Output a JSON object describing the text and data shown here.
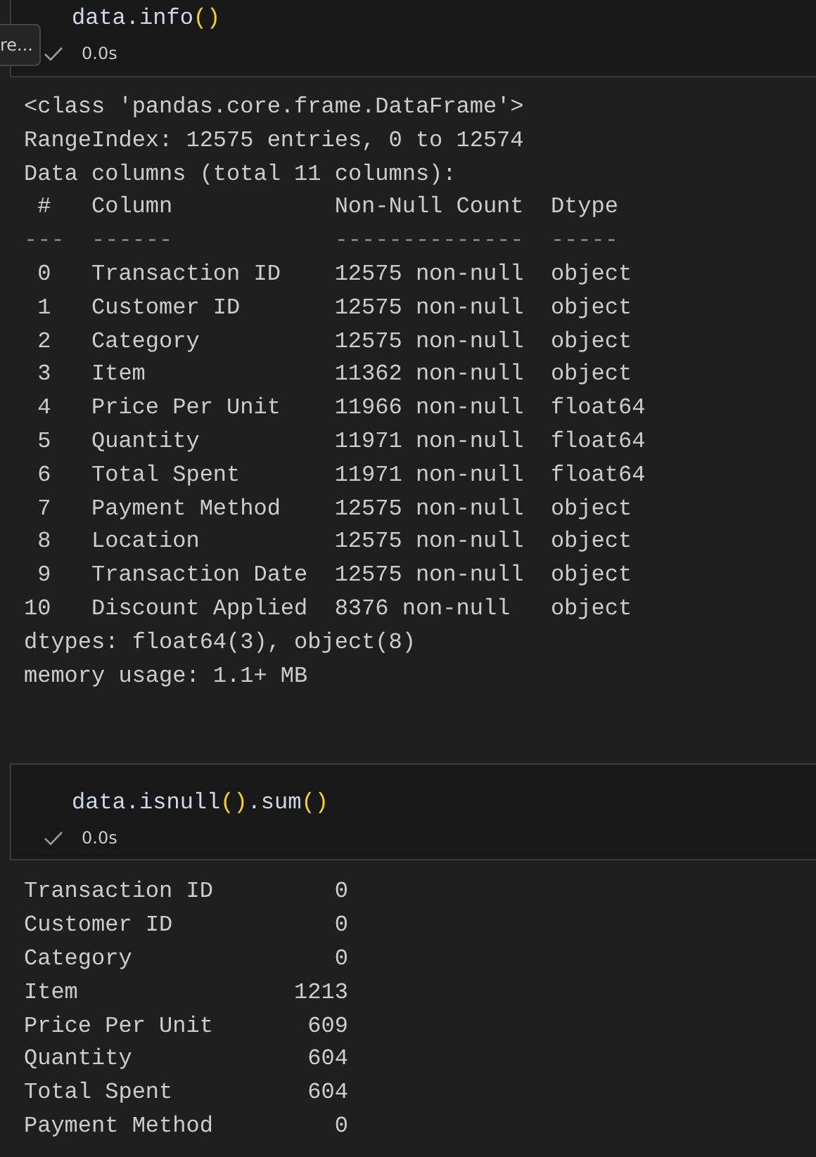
{
  "cells": [
    {
      "code": [
        {
          "text": "data.info",
          "kind": "name"
        },
        {
          "text": "()",
          "kind": "bracket"
        }
      ],
      "time": "0.0s",
      "tooltip": "re...",
      "output": {
        "kind": "info",
        "preamble": [
          "<class 'pandas.core.frame.DataFrame'>",
          "RangeIndex: 12575 entries, 0 to 12574",
          "Data columns (total 11 columns):"
        ],
        "header": [
          "#",
          "Column",
          "Non-Null Count",
          "Dtype"
        ],
        "rule": [
          "---",
          "------",
          "--------------",
          "-----"
        ],
        "rows": [
          {
            "index": "0",
            "column": "Transaction ID",
            "count": "12575 non-null",
            "dtype": "object"
          },
          {
            "index": "1",
            "column": "Customer ID",
            "count": "12575 non-null",
            "dtype": "object"
          },
          {
            "index": "2",
            "column": "Category",
            "count": "12575 non-null",
            "dtype": "object"
          },
          {
            "index": "3",
            "column": "Item",
            "count": "11362 non-null",
            "dtype": "object"
          },
          {
            "index": "4",
            "column": "Price Per Unit",
            "count": "11966 non-null",
            "dtype": "float64"
          },
          {
            "index": "5",
            "column": "Quantity",
            "count": "11971 non-null",
            "dtype": "float64"
          },
          {
            "index": "6",
            "column": "Total Spent",
            "count": "11971 non-null",
            "dtype": "float64"
          },
          {
            "index": "7",
            "column": "Payment Method",
            "count": "12575 non-null",
            "dtype": "object"
          },
          {
            "index": "8",
            "column": "Location",
            "count": "12575 non-null",
            "dtype": "object"
          },
          {
            "index": "9",
            "column": "Transaction Date",
            "count": "12575 non-null",
            "dtype": "object"
          },
          {
            "index": "10",
            "column": "Discount Applied",
            "count": "8376 non-null",
            "dtype": "object"
          }
        ],
        "footer": [
          "dtypes: float64(3), object(8)",
          "memory usage: 1.1+ MB"
        ]
      }
    },
    {
      "code": [
        {
          "text": "data.isnull",
          "kind": "name"
        },
        {
          "text": "()",
          "kind": "bracket"
        },
        {
          "text": ".sum",
          "kind": "name"
        },
        {
          "text": "()",
          "kind": "bracket"
        }
      ],
      "time": "0.0s",
      "output": {
        "kind": "series",
        "rows": [
          {
            "label": "Transaction ID",
            "value": "0"
          },
          {
            "label": "Customer ID",
            "value": "0"
          },
          {
            "label": "Category",
            "value": "0"
          },
          {
            "label": "Item",
            "value": "1213"
          },
          {
            "label": "Price Per Unit",
            "value": "609"
          },
          {
            "label": "Quantity",
            "value": "604"
          },
          {
            "label": "Total Spent",
            "value": "604"
          },
          {
            "label": "Payment Method",
            "value": "0"
          }
        ]
      }
    }
  ]
}
